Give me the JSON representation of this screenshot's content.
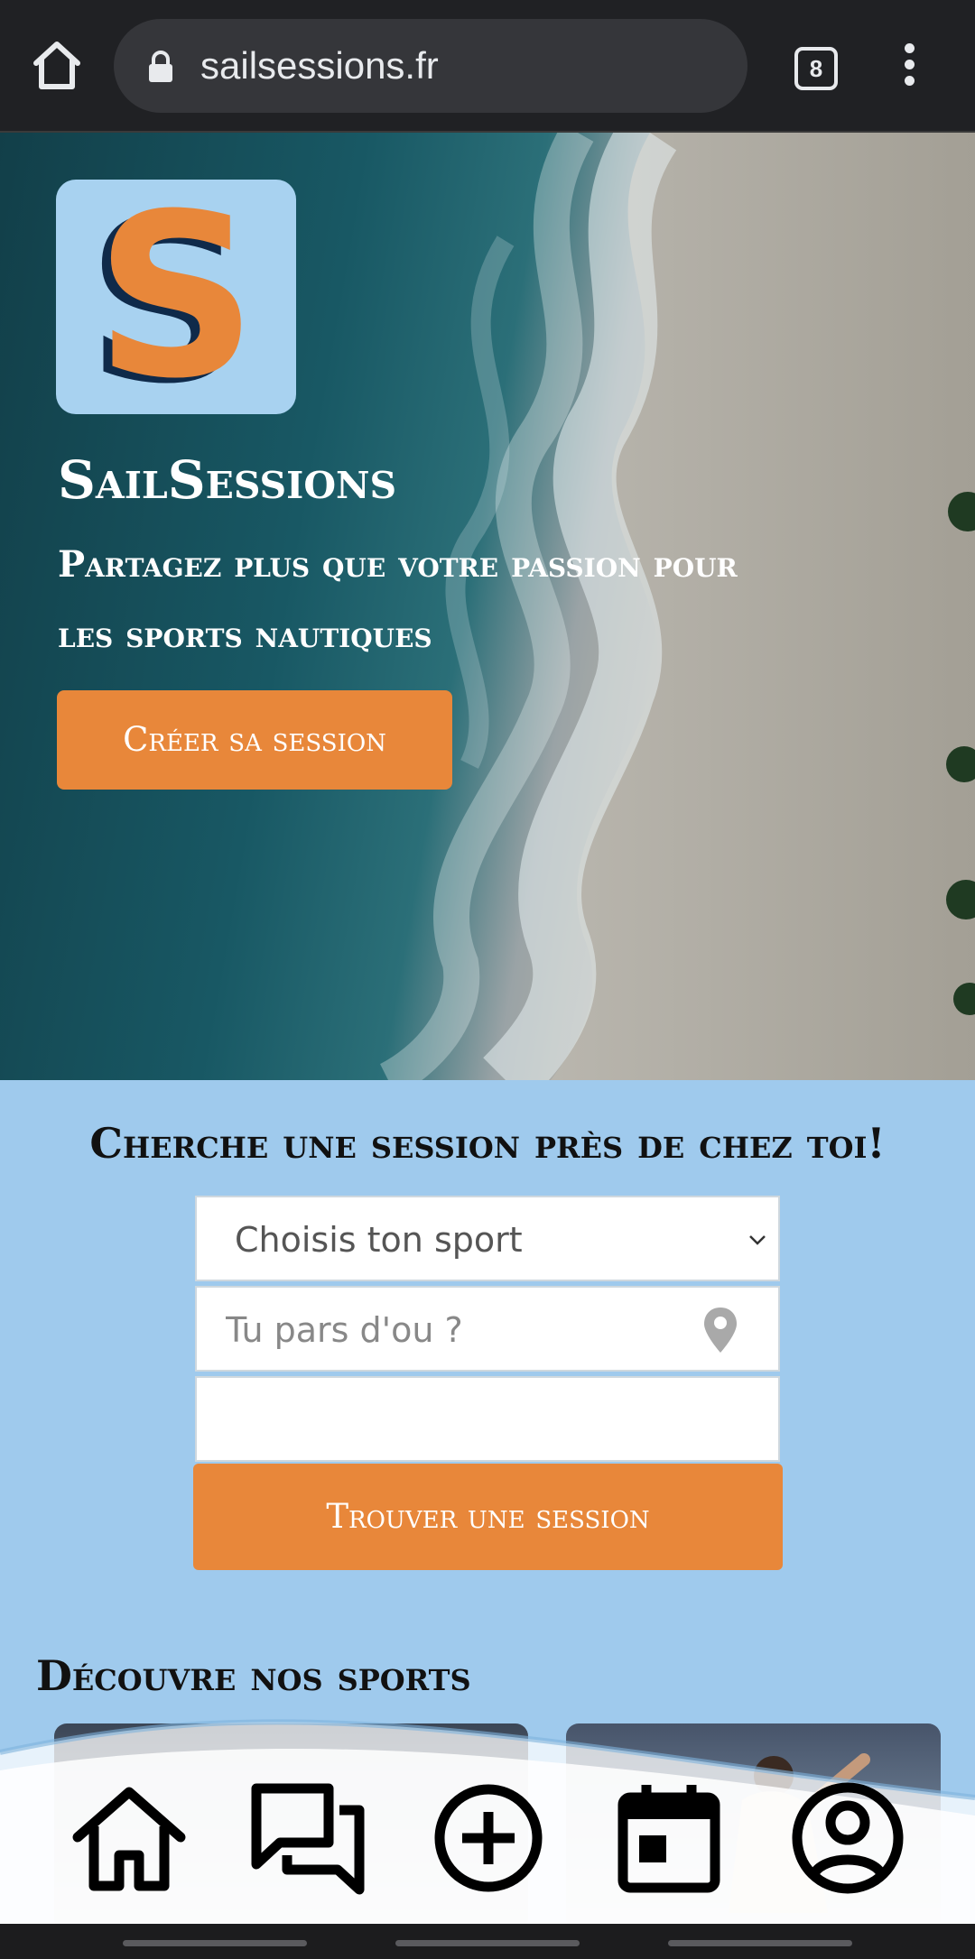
{
  "browser": {
    "url": "sailsessions.fr",
    "tab_count": "8"
  },
  "hero": {
    "logo_letter": "S",
    "brand_name": "SailSessions",
    "tagline": "Partagez plus que votre passion pour les sports nautiques",
    "cta_label": "Créer sa session"
  },
  "search": {
    "title": "Cherche une session près de chez toi!",
    "sport_select": "Choisis ton sport",
    "location_placeholder": "Tu pars d'ou ?",
    "date_value": "",
    "submit_label": "Trouver une session"
  },
  "sports": {
    "title": "Découvre nos sports"
  },
  "bottom_nav": {
    "items": [
      "home-icon",
      "chat-icon",
      "add-circle-icon",
      "calendar-icon",
      "account-icon"
    ]
  },
  "colors": {
    "accent": "#e8873a",
    "section_bg": "#9fcaed",
    "browser_bg": "#202124"
  }
}
